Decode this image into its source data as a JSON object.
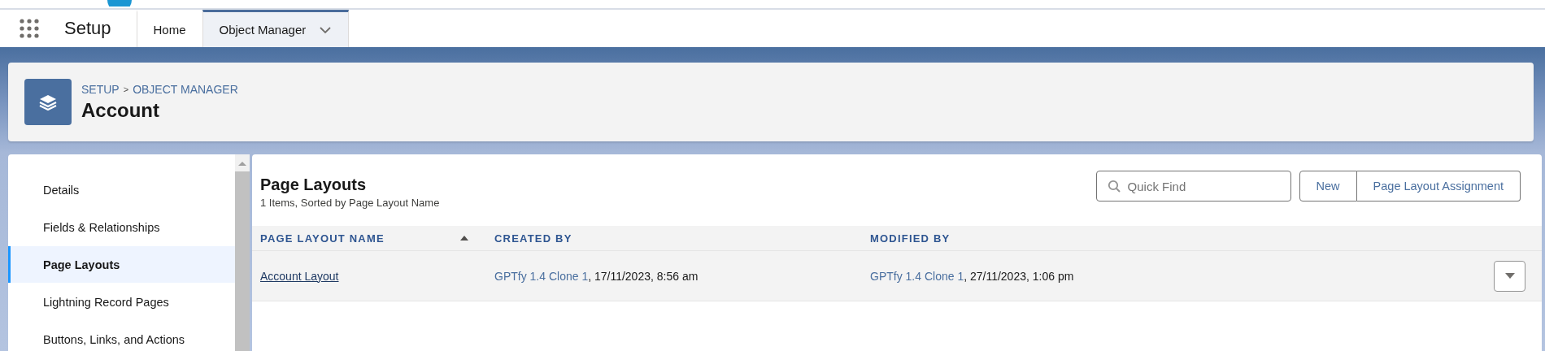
{
  "nav": {
    "app_name": "Setup",
    "tabs": [
      {
        "label": "Home",
        "selected": false,
        "has_menu": false
      },
      {
        "label": "Object Manager",
        "selected": true,
        "has_menu": true
      }
    ]
  },
  "header": {
    "breadcrumbs": [
      "SETUP",
      "OBJECT MANAGER"
    ],
    "separator": ">",
    "title": "Account"
  },
  "sidebar": {
    "items": [
      {
        "label": "Details",
        "selected": false
      },
      {
        "label": "Fields & Relationships",
        "selected": false
      },
      {
        "label": "Page Layouts",
        "selected": true
      },
      {
        "label": "Lightning Record Pages",
        "selected": false
      },
      {
        "label": "Buttons, Links, and Actions",
        "selected": false
      }
    ]
  },
  "content": {
    "title": "Page Layouts",
    "subtitle": "1 Items, Sorted by Page Layout Name",
    "search": {
      "placeholder": "Quick Find"
    },
    "buttons": [
      "New",
      "Page Layout Assignment"
    ],
    "table": {
      "columns": [
        {
          "label": "PAGE LAYOUT NAME",
          "sorted": true
        },
        {
          "label": "CREATED BY",
          "sorted": false
        },
        {
          "label": "MODIFIED BY",
          "sorted": false
        }
      ],
      "rows": [
        {
          "name": "Account Layout",
          "created": {
            "user": "GPTfy 1.4 Clone 1",
            "rest": ", 17/11/2023, 8:56 am"
          },
          "modified": {
            "user": "GPTfy 1.4 Clone 1",
            "rest": ", 27/11/2023, 1:06 pm"
          },
          "has_actions": true
        }
      ]
    }
  }
}
